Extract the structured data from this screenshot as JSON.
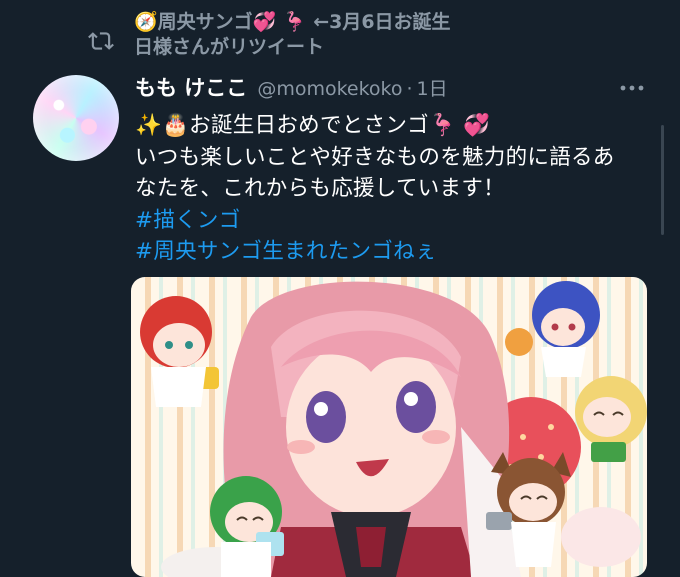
{
  "retweet": {
    "text": "🧭周央サンゴ💞 🦩 ←3月6日お誕生日様さんがリツイート"
  },
  "tweet": {
    "display_name": "もも けここ",
    "handle": "@momokekoko",
    "separator": "·",
    "time": "1日",
    "lines": [
      "✨🎂お誕生日おめでとさンゴ🦩 💞",
      "いつも楽しいことや好きなものを魅力的に語るあ",
      "なたを、これからも応援しています！"
    ],
    "hashtags": [
      "#描くンゴ",
      "#周央サンゴ生まれたンゴねぇ"
    ]
  },
  "icons": {
    "retweet": "retweet-icon",
    "more": "more-options-icon",
    "avatar": "user-avatar"
  },
  "colors": {
    "background": "#15202b",
    "secondary_text": "#8b98a5",
    "hashtag": "#1d9bf0"
  }
}
